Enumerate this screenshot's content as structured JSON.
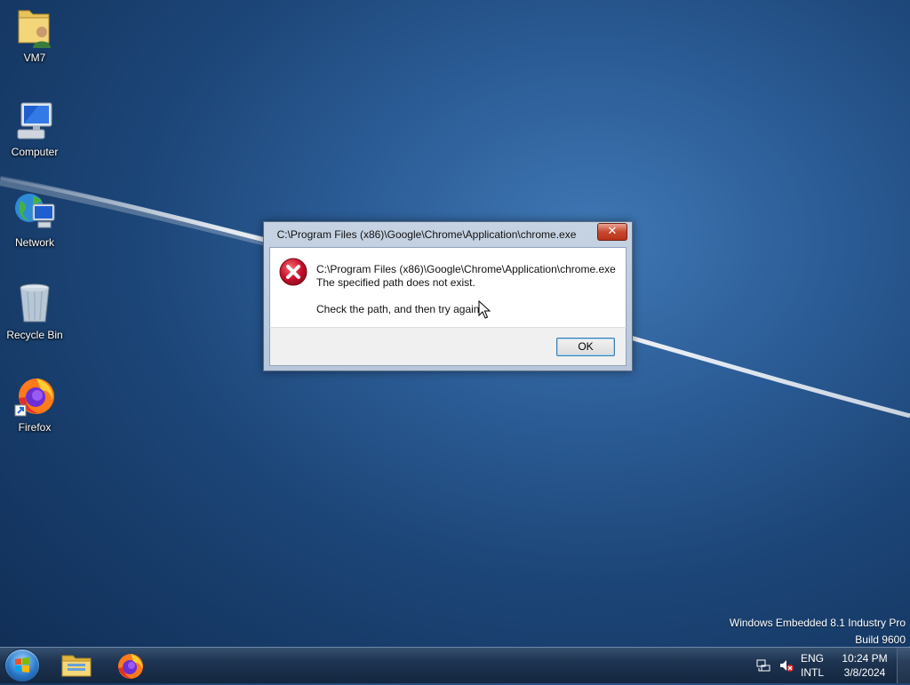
{
  "desktop": {
    "icons": [
      {
        "label": "VM7",
        "icon": "user-folder-icon"
      },
      {
        "label": "Computer",
        "icon": "computer-icon"
      },
      {
        "label": "Network",
        "icon": "network-icon"
      },
      {
        "label": "Recycle Bin",
        "icon": "recycle-bin-icon"
      },
      {
        "label": "Firefox",
        "icon": "firefox-icon"
      }
    ]
  },
  "dialog": {
    "title": "C:\\Program Files (x86)\\Google\\Chrome\\Application\\chrome.exe",
    "close_label": "✕",
    "icon": "error-icon",
    "message_line1": "C:\\Program Files (x86)\\Google\\Chrome\\Application\\chrome.exe",
    "message_line2": "The specified path does not exist.",
    "message_line3": "Check the path, and then try again.",
    "ok_label": "OK"
  },
  "watermark": {
    "line1": "Windows Embedded 8.1 Industry Pro",
    "line2": "Build 9600"
  },
  "taskbar": {
    "pinned": [
      "file-explorer-icon",
      "firefox-icon"
    ],
    "tray": {
      "language": "ENG",
      "layout": "INTL",
      "time": "10:24 PM",
      "date": "3/8/2024"
    }
  },
  "colors": {
    "desktop_bg": "#1c4577",
    "close_button": "#c7472f",
    "error_red": "#c8102e"
  }
}
